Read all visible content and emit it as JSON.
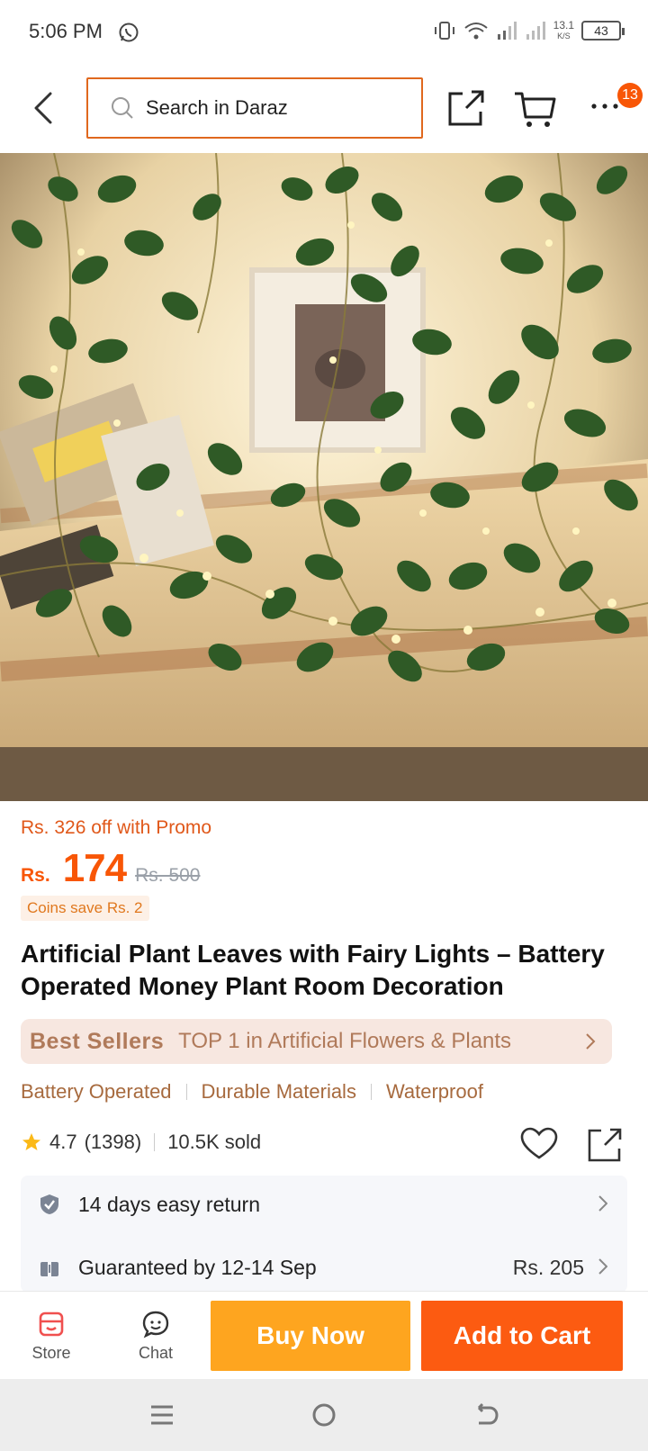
{
  "status_bar": {
    "time": "5:06 PM",
    "net_speed": "13.1",
    "net_unit": "K/S",
    "battery": "43"
  },
  "header": {
    "search_placeholder": "Search in Daraz",
    "cart_badge": "13",
    "accent_color": "#e0681e"
  },
  "product": {
    "image_alt": "Artificial plant leaves with fairy lights",
    "promo_text": "Rs. 326 off with Promo",
    "currency": "Rs.",
    "price": "174",
    "old_price": "Rs. 500",
    "coins_text": "Coins save Rs. 2",
    "title": "Artificial Plant Leaves with Fairy Lights – Battery Operated Money Plant Room Decoration",
    "best_sellers_label": "Best Sellers",
    "best_sellers_text": "TOP 1 in Artificial Flowers & Plants",
    "features": [
      "Battery Operated",
      "Durable Materials",
      "Waterproof"
    ],
    "rating": "4.7",
    "rating_count": "(1398)",
    "sold": "10.5K sold"
  },
  "info": {
    "return_text": "14 days easy return",
    "delivery_text": "Guaranteed by 12-14 Sep",
    "delivery_price": "Rs. 205"
  },
  "action_bar": {
    "store_label": "Store",
    "chat_label": "Chat",
    "buy_now_label": "Buy Now",
    "add_to_cart_label": "Add to Cart",
    "buy_color": "#fea51f",
    "cart_color": "#fc5b11"
  }
}
